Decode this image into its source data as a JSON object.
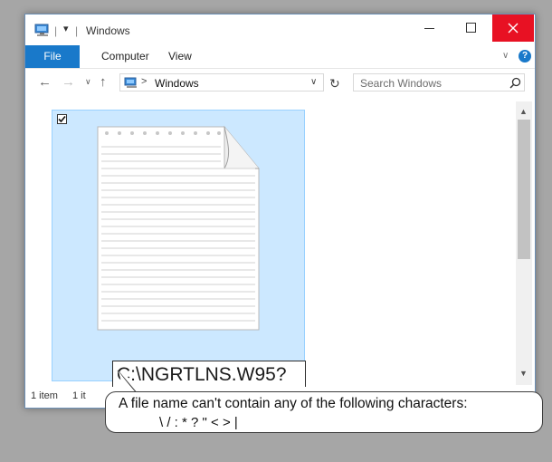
{
  "window": {
    "title": "Windows",
    "qat_separator": "|",
    "qat_customize": "▾"
  },
  "titlebar_buttons": {
    "minimize_icon": "minimize-icon",
    "maximize_icon": "maximize-icon",
    "close_icon": "close-icon",
    "close_color": "#e81123"
  },
  "ribbon": {
    "tabs": [
      {
        "label": "File"
      },
      {
        "label": "Computer"
      },
      {
        "label": "View"
      }
    ],
    "expand_glyph": "∨",
    "help_glyph": "?",
    "accent": "#1979ca"
  },
  "navigation": {
    "back": "←",
    "forward": "→",
    "recent": "∨",
    "up": "↑",
    "address_sep": ">",
    "address_location": "Windows",
    "address_dropdown": "∨",
    "refresh": "↻",
    "search_placeholder": "Search Windows"
  },
  "content": {
    "item_checked": true,
    "item_icon": "text-document-icon",
    "rename_value": "C:\\NGRTLNS.W95?",
    "selection_color": "#cce8ff"
  },
  "scrollbar": {
    "up": "▲",
    "down": "▼"
  },
  "statusbar": {
    "item_count": "1 item",
    "selected_partial": "1 it"
  },
  "tooltip": {
    "line1": "A file name can't contain any of the following characters:",
    "line2": "\\ / : * ? \" < > |"
  }
}
